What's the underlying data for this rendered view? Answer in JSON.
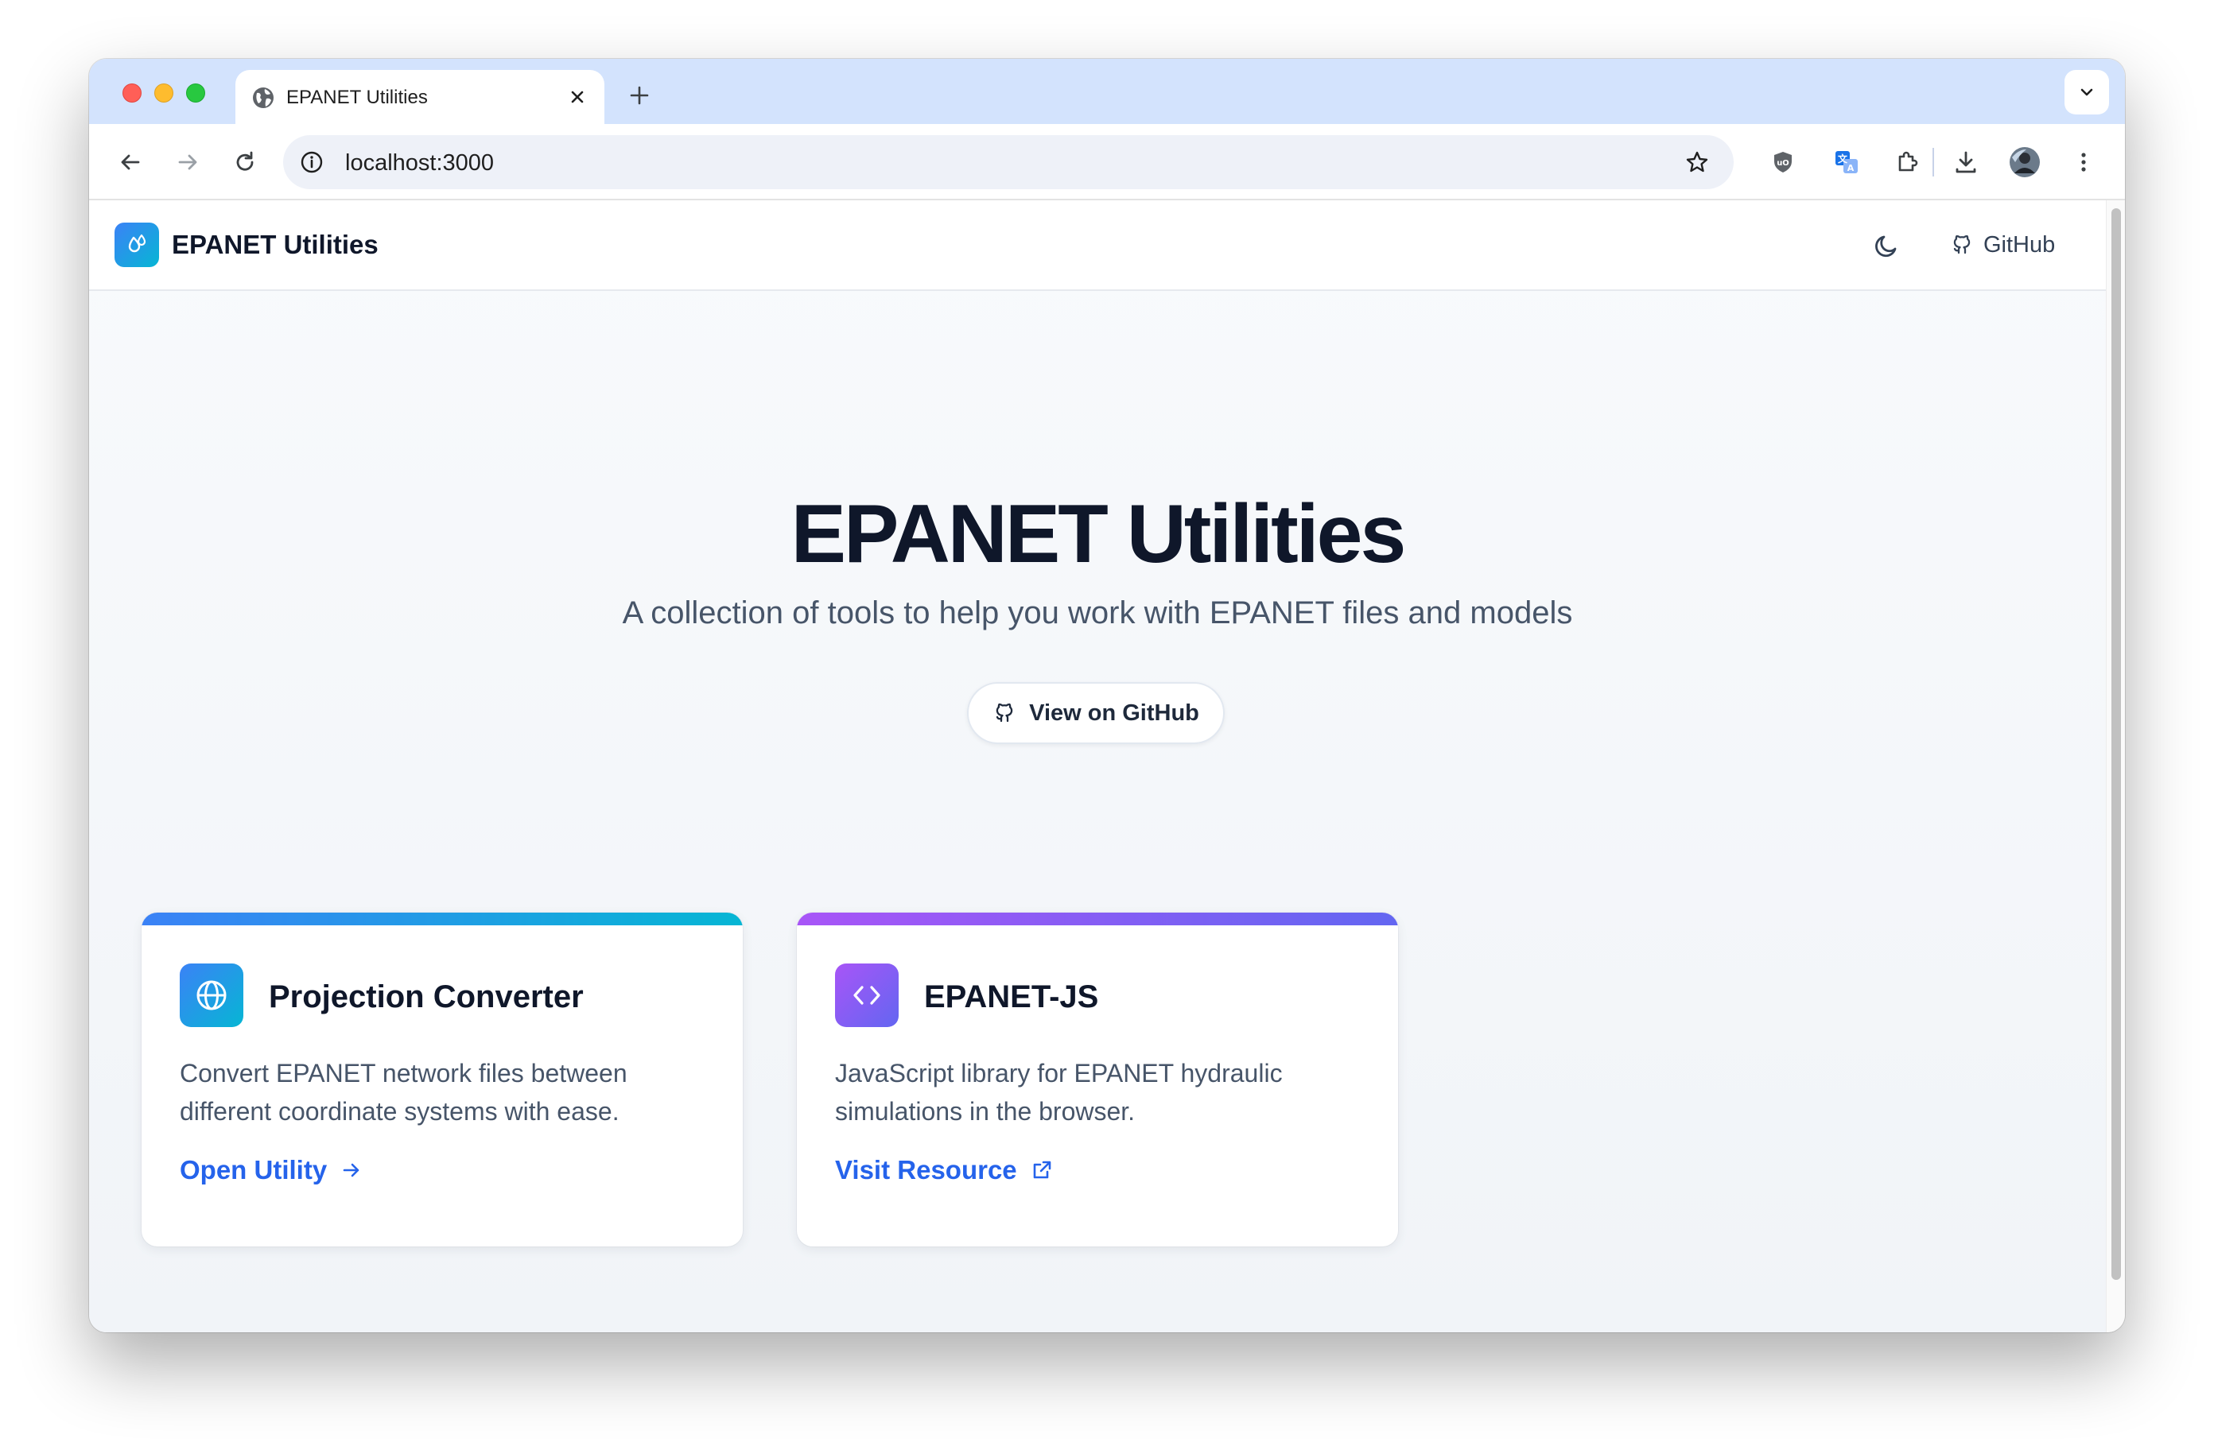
{
  "browser": {
    "tab_title": "EPANET Utilities",
    "url": "localhost:3000"
  },
  "navbar": {
    "brand": "EPANET Utilities",
    "github_label": "GitHub"
  },
  "hero": {
    "title": "EPANET Utilities",
    "subtitle": "A collection of tools to help you work with EPANET files and models",
    "button_label": "View on GitHub"
  },
  "cards": [
    {
      "title": "Projection Converter",
      "description": "Convert EPANET network files between different coordinate systems with ease.",
      "link_label": "Open Utility",
      "icon": "globe-icon",
      "accent": "#3b82f6"
    },
    {
      "title": "EPANET-JS",
      "description": "JavaScript library for EPANET hydraulic simulations in the browser.",
      "link_label": "Visit Resource",
      "icon": "code-icon",
      "accent": "#a855f7"
    }
  ],
  "colors": {
    "link": "#2563eb",
    "heading": "#0f172a",
    "tabstrip": "#d3e3fd"
  }
}
